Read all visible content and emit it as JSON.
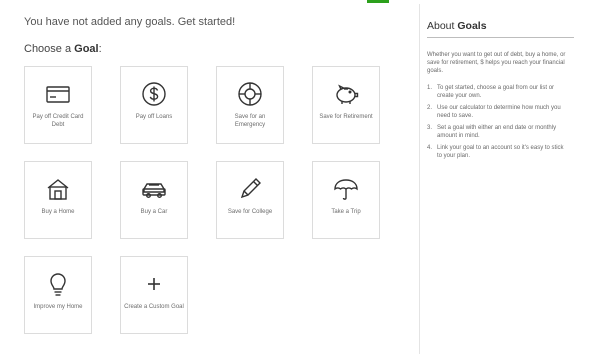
{
  "intro_text": "You have not added any goals. Get started!",
  "choose_prefix": "Choose a ",
  "choose_bold": "Goal",
  "choose_suffix": ":",
  "goals": [
    {
      "label": "Pay off Credit Card Debt",
      "icon": "credit-card-icon"
    },
    {
      "label": "Pay off Loans",
      "icon": "dollar-coin-icon"
    },
    {
      "label": "Save for an Emergency",
      "icon": "life-preserver-icon"
    },
    {
      "label": "Save for Retirement",
      "icon": "piggy-bank-icon"
    },
    {
      "label": "Buy a Home",
      "icon": "house-icon"
    },
    {
      "label": "Buy a Car",
      "icon": "car-icon"
    },
    {
      "label": "Save for College",
      "icon": "pencil-icon"
    },
    {
      "label": "Take a Trip",
      "icon": "umbrella-icon"
    },
    {
      "label": "Improve my Home",
      "icon": "lightbulb-icon"
    },
    {
      "label": "Create a Custom Goal",
      "icon": "plus-icon"
    }
  ],
  "about": {
    "title_prefix": "About ",
    "title_bold": "Goals",
    "description": "Whether you want to get out of debt, buy a home, or save for retirement, $ helps you reach your financial goals.",
    "steps": [
      {
        "n": "1.",
        "text": "To get started, choose a goal from our list or create your own."
      },
      {
        "n": "2.",
        "text": "Use our calculator to determine how much you need to save."
      },
      {
        "n": "3.",
        "text": "Set a goal with either an end date or monthly amount in mind."
      },
      {
        "n": "4.",
        "text": "Link your goal to an account so it's easy to stick to your plan."
      }
    ]
  }
}
